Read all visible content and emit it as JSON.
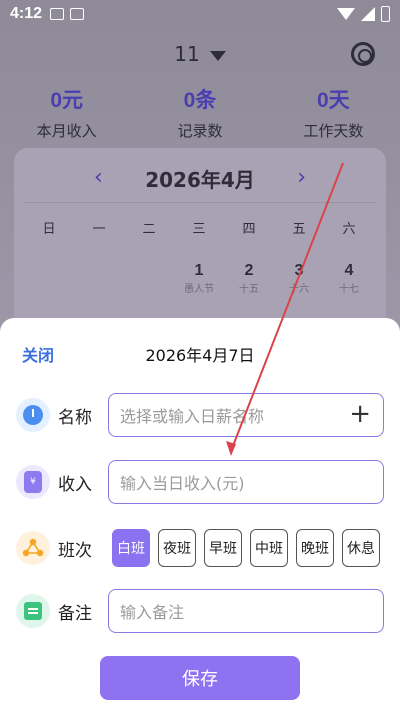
{
  "status_bar": {
    "time": "4:12"
  },
  "header": {
    "month_value": "11"
  },
  "stats": [
    {
      "value": "0元",
      "label": "本月收入"
    },
    {
      "value": "0条",
      "label": "记录数"
    },
    {
      "value": "0天",
      "label": "工作天数"
    }
  ],
  "calendar": {
    "title": "2026年4月",
    "weekdays": [
      "日",
      "一",
      "二",
      "三",
      "四",
      "五",
      "六"
    ],
    "days": [
      {
        "num": "1",
        "sub": "愚人节"
      },
      {
        "num": "2",
        "sub": "十五"
      },
      {
        "num": "3",
        "sub": "十六"
      },
      {
        "num": "4",
        "sub": "十七"
      }
    ]
  },
  "sheet": {
    "close_label": "关闭",
    "date_title": "2026年4月7日",
    "name": {
      "label": "名称",
      "placeholder": "选择或输入日薪名称"
    },
    "income": {
      "label": "收入",
      "placeholder": "输入当日收入(元)"
    },
    "shift": {
      "label": "班次",
      "options": [
        "白班",
        "夜班",
        "早班",
        "中班",
        "晚班",
        "休息"
      ],
      "selected": "白班"
    },
    "note": {
      "label": "备注",
      "placeholder": "输入备注"
    },
    "save_label": "保存"
  },
  "colors": {
    "accent": "#8f72f0",
    "link": "#3b6fe0",
    "stat_value": "#4a3fb0",
    "annotation_arrow": "#d9434a"
  }
}
